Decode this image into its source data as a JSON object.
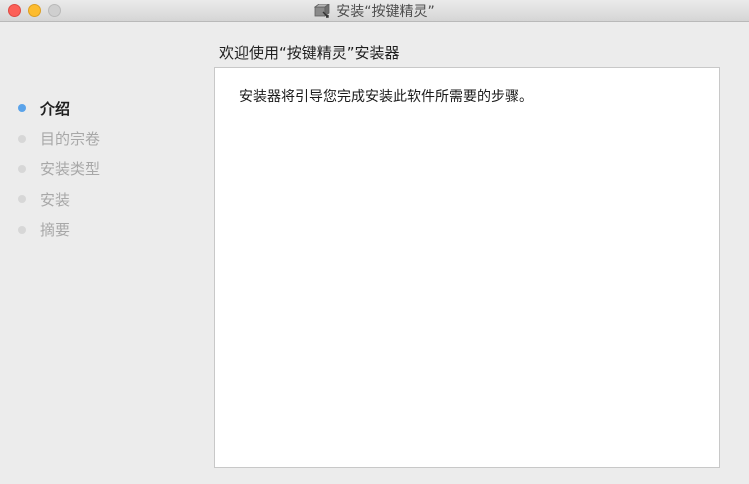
{
  "window": {
    "title": "安装“按键精灵”",
    "icon": "installer-package-icon"
  },
  "sidebar": {
    "steps": [
      {
        "label": "介绍",
        "state": "active"
      },
      {
        "label": "目的宗卷",
        "state": "pending"
      },
      {
        "label": "安装类型",
        "state": "pending"
      },
      {
        "label": "安装",
        "state": "pending"
      },
      {
        "label": "摘要",
        "state": "pending"
      }
    ]
  },
  "main": {
    "heading": "欢迎使用“按键精灵”安装器",
    "body": "安装器将引导您完成安装此软件所需要的步骤。"
  },
  "colors": {
    "active_dot": "#5aa3ea",
    "inactive_dot": "#d7d7d7",
    "close": "#fc5f57",
    "minimize": "#fdbc2e",
    "zoom_disabled": "#cfcfcf"
  }
}
